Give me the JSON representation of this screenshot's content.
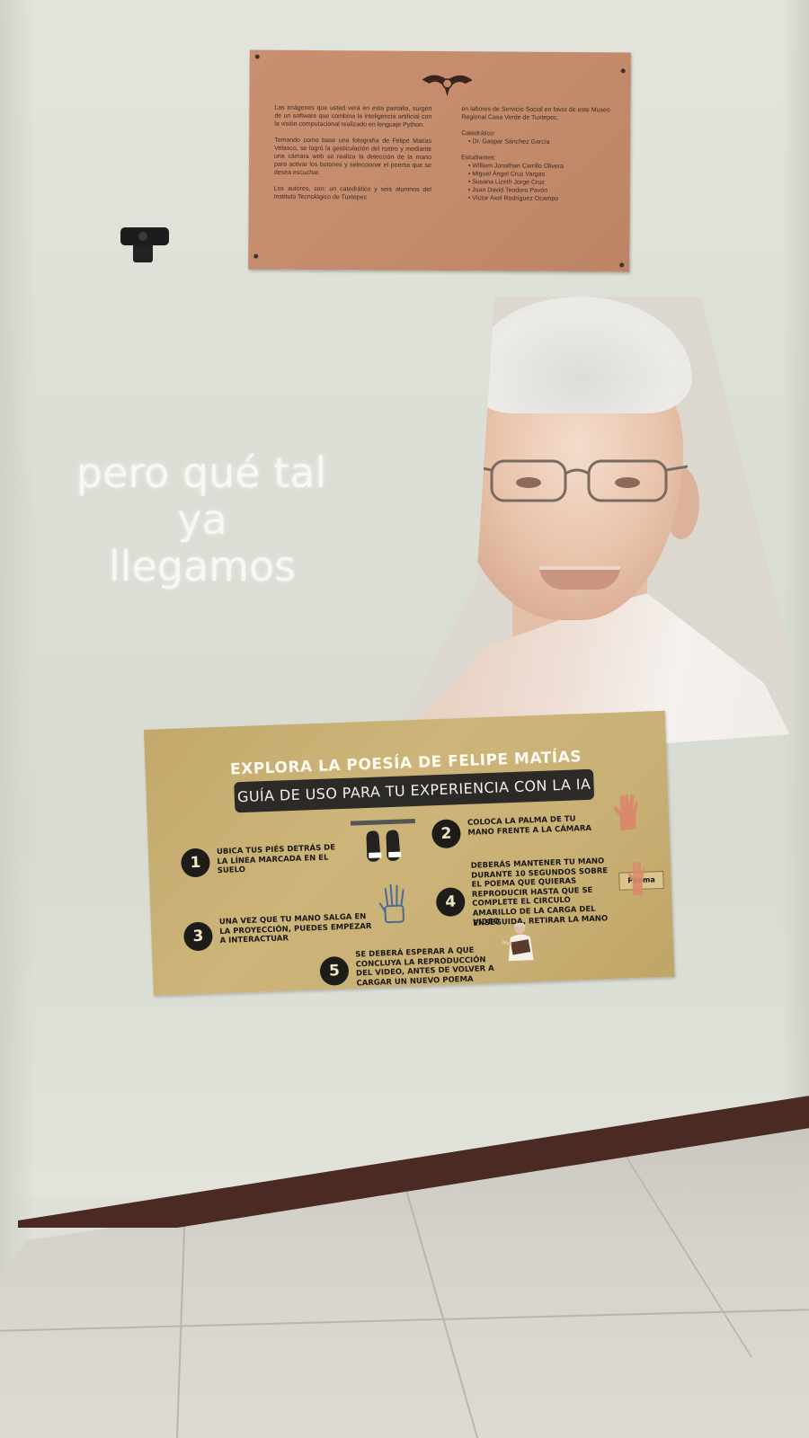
{
  "plaque": {
    "paragraph_1": "Las imágenes que usted verá en esta pantalla, surgen de un software que combina la inteligencia artificial con la visión computacional realizado en lenguaje Python.",
    "paragraph_2": "Tomando como base una fotografía de Felipe Matías Velasco, se logró la gesticulación del rostro y mediante una cámara web se realiza la detección de la mano para activar los botones y seleccionar el poema que se desea escuchar.",
    "paragraph_3": "Los autores, son: un catedrático y seis alumnos del Instituto Tecnológico de Tuxtepec",
    "paragraph_4": "en labores de Servicio Social en favor de este Museo Regional Casa Verde de Tuxtepec.",
    "professor_heading": "Catedrático:",
    "professor": "Dr. Gaspar Sánchez García",
    "students_heading": "Estudiantes:",
    "students": [
      "William Jonathan Carrillo Olivera",
      "Miguel Ángel Cruz Vargas",
      "Susana Lizeth Jorge Cruz",
      "Juan David Teodoro Pavón",
      "Víctor Axel Rodríguez Ocampo"
    ]
  },
  "projection": {
    "line_1": "pero qué tal",
    "line_2": "ya",
    "line_3": "llegamos"
  },
  "poster": {
    "title": "EXPLORA LA POESÍA DE FELIPE MATÍAS",
    "subtitle": "GUÍA DE USO PARA TU EXPERIENCIA CON LA IA",
    "steps": [
      {
        "number": "1",
        "text": "Ubica tus piés detrás de la línea marcada en el suelo",
        "icon": "sneakers-icon"
      },
      {
        "number": "2",
        "text": "Coloca la palma de tu mano frente a la cámara",
        "icon": "hand-palm-icon"
      },
      {
        "number": "3",
        "text": "Una vez que tu mano salga en la proyección, puedes empezar a interactuar",
        "icon": "robot-hand-icon"
      },
      {
        "number": "4",
        "text": "Deberás mantener tu mano durante 10 segundos sobre el poema que quieras reproducir hasta que se complete el circulo amarillo de la carga del video",
        "icon": "hand-on-button-icon"
      },
      {
        "number": "5",
        "text": "Se deberá esperar a que concluya la reproducción del video, antes de volver a cargar un nuevo poema",
        "icon": "poet-reading-icon"
      }
    ],
    "step_4_note": "Enseguida, retirar la mano",
    "poema_label": "Poema"
  },
  "colors": {
    "wall": "#dcdfd6",
    "plaque": "#c48b6c",
    "poster": "#c9b075",
    "baseboard": "#4a2a22",
    "floor": "#d6d3cc",
    "projection_text": "#f7f8f5"
  }
}
